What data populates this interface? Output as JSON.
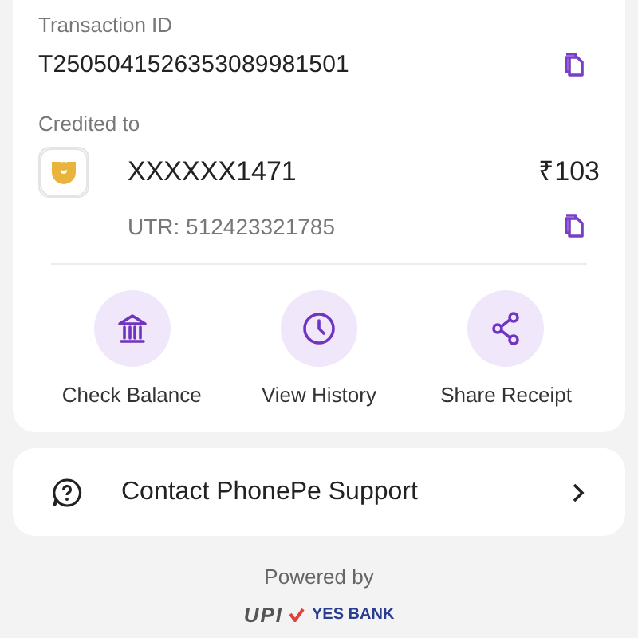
{
  "transaction": {
    "label": "Transaction ID",
    "id": "T2505041526353089981501"
  },
  "credited": {
    "label": "Credited to",
    "account": "XXXXXX1471",
    "amount": "₹103",
    "utr": "UTR: 512423321785"
  },
  "actions": [
    {
      "kind": "bank",
      "label": "Check Balance"
    },
    {
      "kind": "clock",
      "label": "View History"
    },
    {
      "kind": "share",
      "label": "Share Receipt"
    }
  ],
  "support": {
    "label": "Contact PhonePe Support"
  },
  "footer": {
    "powered": "Powered by",
    "upi": "UPI",
    "bank": "YES BANK"
  }
}
